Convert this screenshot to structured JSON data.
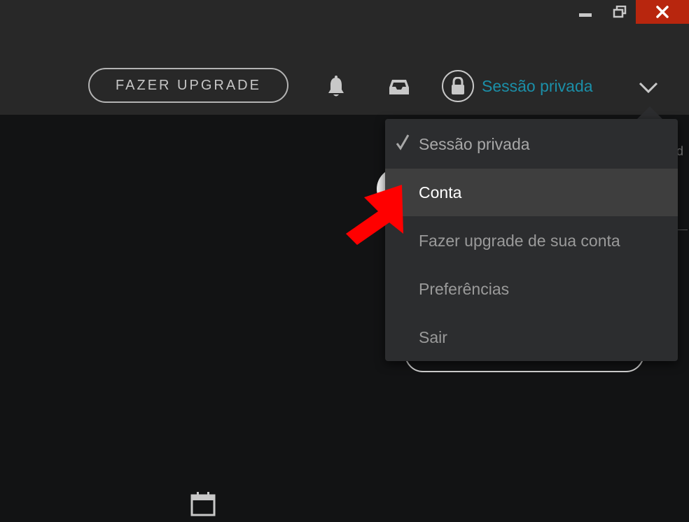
{
  "header": {
    "upgrade_label": "FAZER UPGRADE",
    "session_label": "Sessão privada"
  },
  "menu": {
    "items": [
      {
        "label": "Sessão privada",
        "checked": true
      },
      {
        "label": "Conta",
        "highlighted": true
      },
      {
        "label": "Fazer upgrade de sua conta"
      },
      {
        "label": "Preferências"
      },
      {
        "label": "Sair"
      }
    ]
  },
  "colors": {
    "accent": "#1b8fa8",
    "close_button": "#b8260e",
    "annotation_arrow": "#ff0000",
    "topbar": "#282828",
    "background": "#121314"
  },
  "icons": [
    "minimize-icon",
    "restore-icon",
    "close-icon",
    "bell-icon",
    "inbox-icon",
    "lock-icon",
    "chevron-down-icon",
    "check-icon",
    "calendar-icon"
  ]
}
